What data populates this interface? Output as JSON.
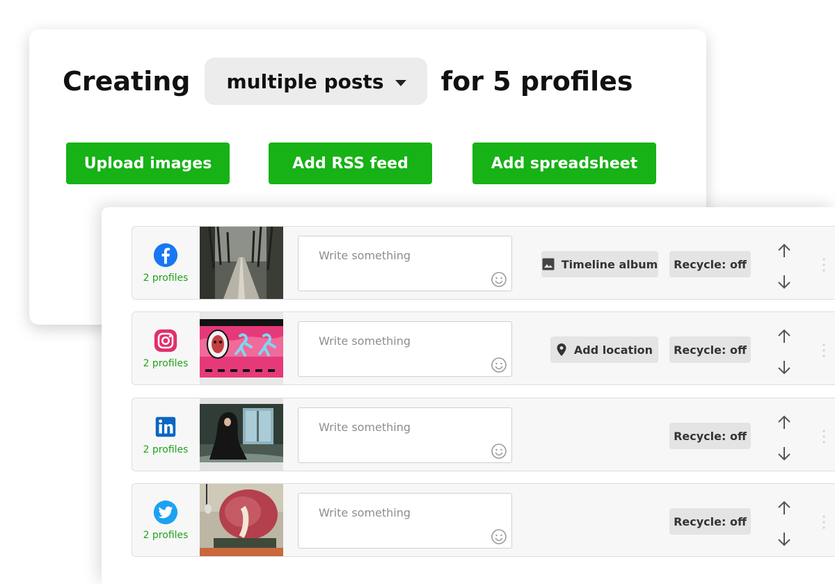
{
  "header": {
    "prefix": "Creating",
    "mode": "multiple posts",
    "suffix": "for 5 profiles"
  },
  "actions": {
    "upload": "Upload images",
    "rss": "Add RSS feed",
    "spreadsheet": "Add spreadsheet"
  },
  "colors": {
    "accent_green": "#16b216",
    "profiles_green": "#23a21f",
    "facebook": "#1877f2",
    "instagram": "#e1306c",
    "linkedin": "#0a66c2",
    "twitter": "#1da1f2"
  },
  "rows": [
    {
      "network": "facebook",
      "icon": "facebook-icon",
      "profiles": "2 profiles",
      "placeholder": "Write something",
      "extra": "Timeline album",
      "extra_icon": "image-icon",
      "recycle": "Recycle: off"
    },
    {
      "network": "instagram",
      "icon": "instagram-icon",
      "profiles": "2 profiles",
      "placeholder": "Write something",
      "extra": "Add location",
      "extra_icon": "location-pin-icon",
      "recycle": "Recycle: off"
    },
    {
      "network": "linkedin",
      "icon": "linkedin-icon",
      "profiles": "2 profiles",
      "placeholder": "Write something",
      "recycle": "Recycle: off"
    },
    {
      "network": "twitter",
      "icon": "twitter-icon",
      "profiles": "2 profiles",
      "placeholder": "Write something",
      "recycle": "Recycle: off"
    }
  ]
}
